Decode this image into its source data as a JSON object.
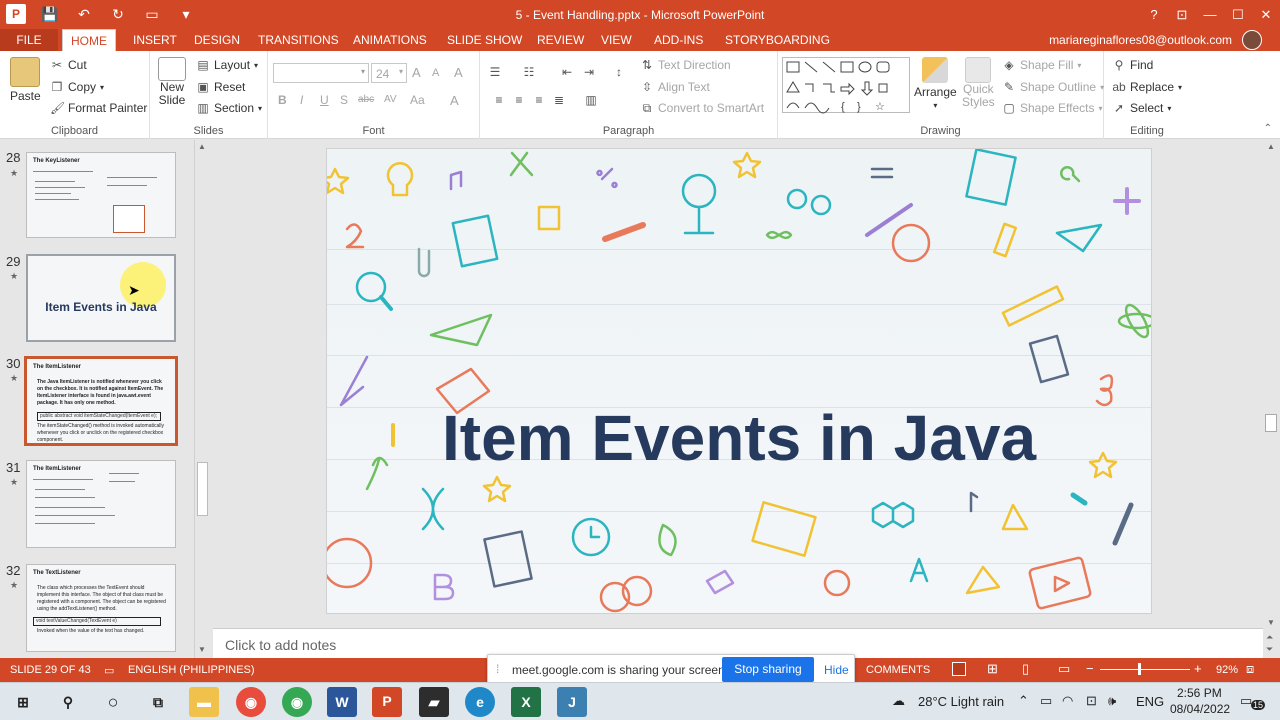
{
  "window": {
    "title": "5 - Event Handling.pptx - Microsoft PowerPoint",
    "controls": [
      "?",
      "⊡",
      "—",
      "☐",
      "✕"
    ]
  },
  "colors": {
    "accent": "#D24726",
    "slide_title": "#263A5E",
    "selected_thumb_border": "#C9582F",
    "share_button": "#1A73E8"
  },
  "tabs": [
    {
      "label": "FILE"
    },
    {
      "label": "HOME"
    },
    {
      "label": "INSERT"
    },
    {
      "label": "DESIGN"
    },
    {
      "label": "TRANSITIONS"
    },
    {
      "label": "ANIMATIONS"
    },
    {
      "label": "SLIDE SHOW"
    },
    {
      "label": "REVIEW"
    },
    {
      "label": "VIEW"
    },
    {
      "label": "ADD-INS"
    },
    {
      "label": "STORYBOARDING"
    }
  ],
  "active_tab": "HOME",
  "account": "mariareginaflores08@outlook.com",
  "ribbon": {
    "clipboard": {
      "paste": "Paste",
      "cut": "Cut",
      "copy": "Copy",
      "format_painter": "Format Painter",
      "label": "Clipboard"
    },
    "slides": {
      "new_slide_1": "New",
      "new_slide_2": "Slide",
      "layout": "Layout",
      "reset": "Reset",
      "section": "Section",
      "label": "Slides"
    },
    "font": {
      "font_name": "",
      "font_size": "24",
      "grow": "A",
      "shrink": "A",
      "clear": "A",
      "bold": "B",
      "italic": "I",
      "underline": "U",
      "shadow": "S",
      "strike": "abc",
      "spacing": "AV",
      "case": "Aa",
      "color": "A",
      "label": "Font"
    },
    "paragraph": {
      "text_direction": "Text Direction",
      "align_text": "Align Text",
      "convert_smartart": "Convert to SmartArt",
      "label": "Paragraph"
    },
    "drawing": {
      "arrange": "Arrange",
      "quick_styles_1": "Quick",
      "quick_styles_2": "Styles",
      "shape_fill": "Shape Fill",
      "shape_outline": "Shape Outline",
      "shape_effects": "Shape Effects",
      "label": "Drawing"
    },
    "editing": {
      "find": "Find",
      "replace": "Replace",
      "select": "Select",
      "label": "Editing"
    }
  },
  "thumbnails": [
    {
      "num": "28",
      "title": "The KeyListener"
    },
    {
      "num": "29",
      "title": "Item Events  in Java"
    },
    {
      "num": "30",
      "title": "The ItemListener",
      "body": "The Java ItemListener is notified whenever you click on the checkbox. It is notified against ItemEvent. The ItemListener interface is found in java.awt.event package. It has only one method.",
      "code": "public abstract void itemStateChanged(ItemEvent e);",
      "body2": "The itemStateChanged() method is invoked automatically whenever you click or unclick on the registered checkbox component."
    },
    {
      "num": "31",
      "title": "The ItemListener"
    },
    {
      "num": "32",
      "title": "The TextListener",
      "body": "The class which processes the TextEvent should implement this interface. The object of that class must be registered with a component. The object can be registered using the addTextListener() method.",
      "code": "void textValueChanged(TextEvent e)",
      "body2": "Invoked when the value of the text has changed."
    }
  ],
  "slide": {
    "title": "Item Events in Java"
  },
  "notes": {
    "placeholder": "Click to add notes"
  },
  "status": {
    "slide_info": "SLIDE 29 OF 43",
    "language": "ENGLISH (PHILIPPINES)",
    "comments": "COMMENTS",
    "zoom": "92%"
  },
  "share_bar": {
    "message": "meet.google.com is sharing your screen.",
    "stop": "Stop sharing",
    "hide": "Hide"
  },
  "taskbar": {
    "weather": "28°C  Light rain",
    "lang": "ENG",
    "time": "2:56 PM",
    "date": "08/04/2022",
    "notifications": "15"
  }
}
